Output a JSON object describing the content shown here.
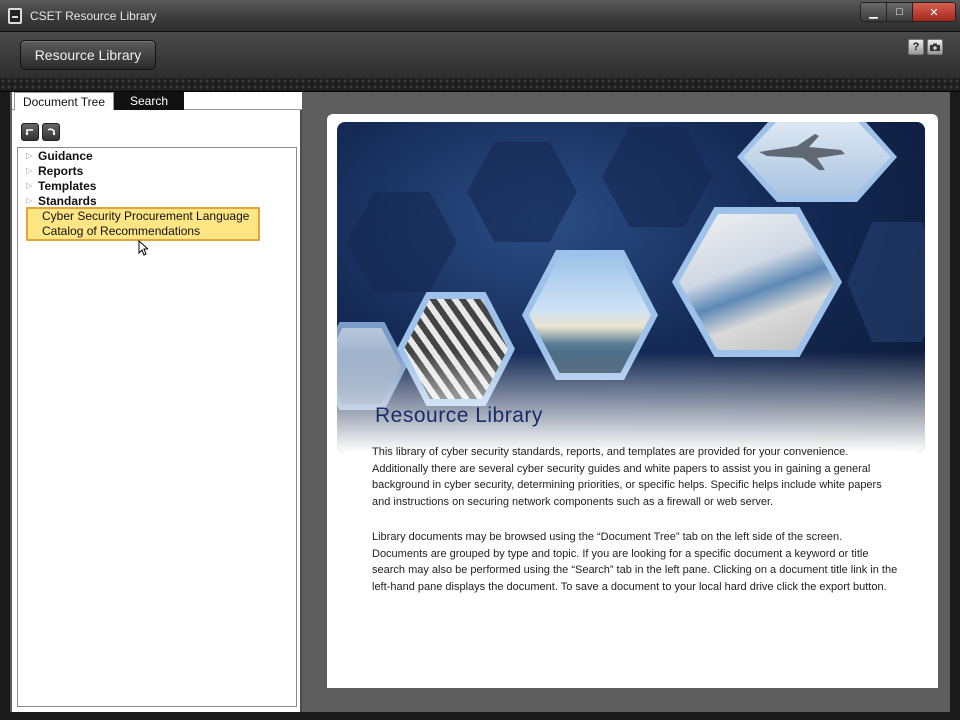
{
  "window": {
    "title": "CSET Resource Library",
    "controls": {
      "minimize": "▁",
      "maximize": "□",
      "close": "✕"
    }
  },
  "header": {
    "title_button": "Resource Library",
    "help": "?",
    "camera_icon": "camera-icon"
  },
  "tabs": [
    {
      "label": "Document Tree",
      "active": true
    },
    {
      "label": "Search",
      "active": false
    }
  ],
  "toolbar": {
    "collapse_icon": "collapse-icon",
    "expand_icon": "expand-icon"
  },
  "tree": {
    "items": [
      {
        "label": "Guidance"
      },
      {
        "label": "Reports"
      },
      {
        "label": "Templates"
      },
      {
        "label": "Standards"
      }
    ],
    "highlighted": [
      "Cyber Security Procurement Language",
      "Catalog of Recommendations"
    ]
  },
  "content": {
    "banner_title": "Resource Library",
    "paragraphs": [
      "This library of cyber security standards, reports, and templates are provided for your convenience. Additionally there are several cyber security guides and white papers to assist you in gaining a general background in cyber security, determining priorities, or specific helps. Specific helps include white papers and instructions on securing network components such as a firewall or web server.",
      "Library documents may be browsed using the “Document Tree” tab on the left side of the screen. Documents are grouped by type and topic. If you are looking for a specific document a keyword or title search may also be performed using the “Search” tab in the left pane. Clicking on a document title link in the left-hand pane displays the document. To save a document to your local hard drive click the export button."
    ]
  },
  "colors": {
    "highlight_fill": "#fde683",
    "highlight_border": "#e3a43a",
    "title_blue": "#1a2c6b"
  }
}
